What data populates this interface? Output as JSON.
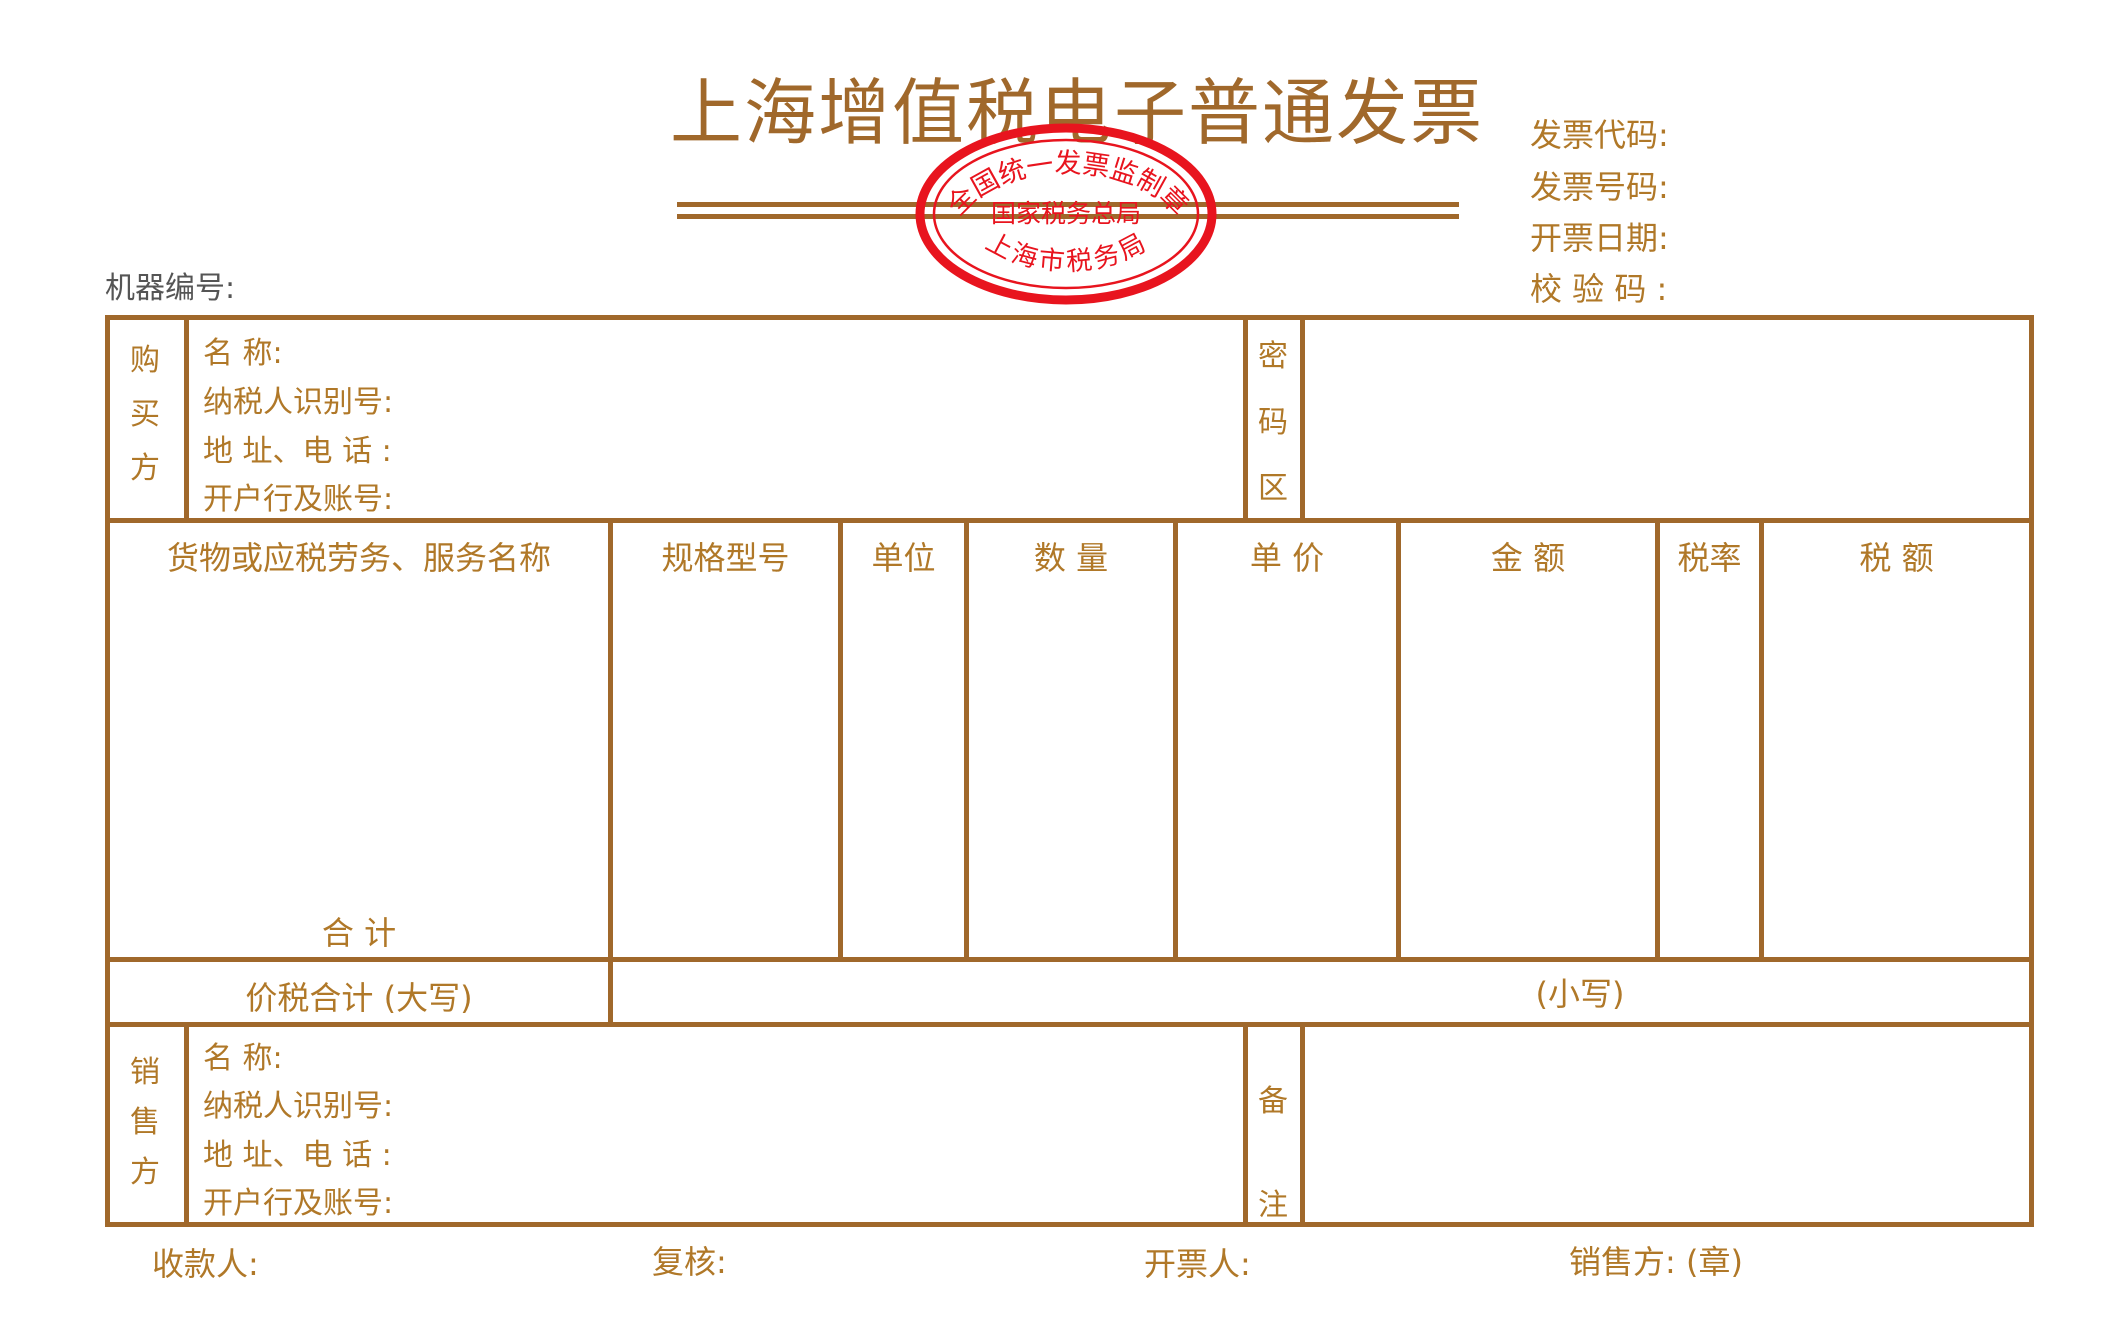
{
  "header": {
    "title": "上海增值税电子普通发票",
    "invoice_code_label": "发票代码:",
    "invoice_number_label": "发票号码:",
    "issue_date_label": "开票日期:",
    "check_code_label": "校 验 码 :",
    "machine_number_label": "机器编号:"
  },
  "stamp": {
    "top_arc": "全国统一发票监制章",
    "middle": "国家税务总局",
    "bottom_arc": "上海市税务局",
    "color": "#e8141e"
  },
  "buyer": {
    "side_label": [
      "购",
      "买",
      "方"
    ],
    "name_label": "名          称:",
    "taxpayer_id_label": "纳税人识别号:",
    "address_phone_label": "地 址、电 话 :",
    "bank_account_label": "开户行及账号:",
    "password_area_label": [
      "密",
      "码",
      "区"
    ]
  },
  "items_table": {
    "columns": [
      "货物或应税劳务、服务名称",
      "规格型号",
      "单位",
      "数 量",
      "单 价",
      "金  额",
      "税率",
      "税  额"
    ],
    "total_label": "合          计"
  },
  "totals": {
    "uppercase_label": "价税合计 (大写)",
    "lowercase_label": "(小写)"
  },
  "seller": {
    "side_label": [
      "销",
      "售",
      "方"
    ],
    "name_label": "名          称:",
    "taxpayer_id_label": "纳税人识别号:",
    "address_phone_label": "地 址、电 话 :",
    "bank_account_label": "开户行及账号:",
    "remarks_label": [
      "备",
      "注"
    ]
  },
  "footer": {
    "payee_label": "收款人:",
    "reviewer_label": "复核:",
    "issuer_label": "开票人:",
    "seller_seal_label": "销售方: (章)"
  },
  "colors": {
    "line": "#a0682b",
    "text": "#b07828",
    "stamp": "#e8141e"
  }
}
